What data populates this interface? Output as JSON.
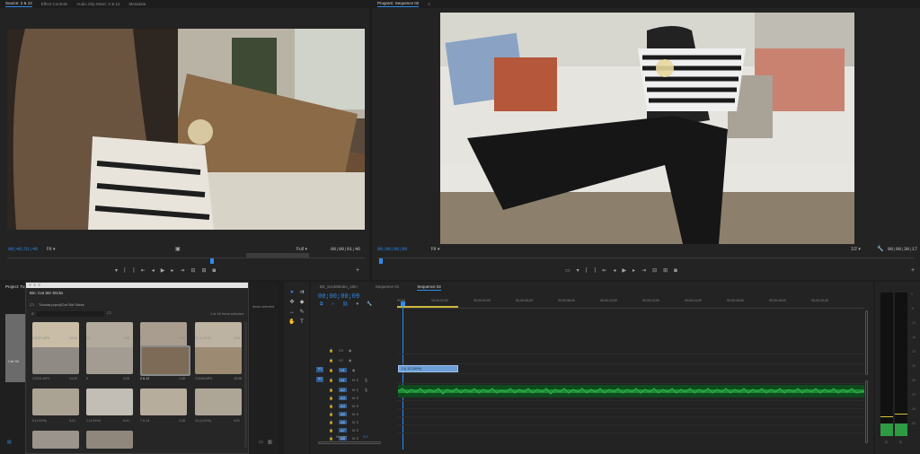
{
  "source_monitor": {
    "tabs": [
      {
        "label": "Source: 2 & 12",
        "active": true
      },
      {
        "label": "Effect Controls",
        "active": false
      },
      {
        "label": "Audio Clip Mixer: 2 & 12",
        "active": false
      },
      {
        "label": "Metadata",
        "active": false
      }
    ],
    "timecode_current": "00;40;51;40",
    "fit": "Fit",
    "quality": "Full",
    "timecode_duration": "00;00;01;46"
  },
  "program_monitor": {
    "tab_label": "Program: Sequence 02",
    "timecode_current": "00;00;00;09",
    "fit": "Fit",
    "ratio": "1/2",
    "timecode_duration": "00;00;30;17"
  },
  "project_panel": {
    "tab_label": "Project: Tu",
    "bin_tab_label": "Bin: Cat Stir Sticks",
    "path": "Tutorial.prproj\\Cat Stir Sticks",
    "items_selected": "1 of 18 items selected",
    "partial_selected": "items selected",
    "partial_label": "Cat Sti",
    "thumbnails": [
      {
        "name": "C0027.MP4",
        "dur": "44;26"
      },
      {
        "name": "13",
        "dur": "2;08"
      },
      {
        "name": "8",
        "dur": "2;45"
      },
      {
        "name": "11 (1:2X%)",
        "dur": "4;26"
      },
      {
        "name": "C0021.MP4",
        "dur": "14;20"
      },
      {
        "name": "9",
        "dur": "3;26"
      },
      {
        "name": "2 & 12",
        "dur": "1;46"
      },
      {
        "name": "C0048.MP4",
        "dur": "15;38"
      },
      {
        "name": "6 (1:2X%)",
        "dur": "4;21"
      },
      {
        "name": "1 (1:2X%)",
        "dur": "6;41"
      },
      {
        "name": "7 & 14",
        "dur": "2;28"
      },
      {
        "name": "10 (1:2X%)",
        "dur": "4;21"
      }
    ]
  },
  "timeline": {
    "tabs": [
      {
        "label": "B2_SockWideo_10in",
        "active": false
      },
      {
        "label": "Sequence 01",
        "active": false
      },
      {
        "label": "Sequence 02",
        "active": true
      }
    ],
    "timecode": "00;00;00;09",
    "ruler": [
      "00;00",
      "00;00;02;00",
      "00;00;04;00",
      "00;00;06;00",
      "00;00;08;00",
      "00;00;10;00",
      "00;00;12;00",
      "00;00;14;00",
      "00;00;16;00",
      "00;00;18;00",
      "00;00;20;00"
    ],
    "video_tracks": [
      "V3",
      "V2",
      "V1"
    ],
    "audio_tracks": [
      "A1",
      "A2",
      "A3",
      "A4",
      "A5",
      "A6",
      "A7",
      "A8"
    ],
    "master_label": "Master",
    "master_value": "0.0",
    "clip_label": "2 & 12 [150%]"
  },
  "meter": {
    "scale": [
      "0",
      "-6",
      "-12",
      "-18",
      "-24",
      "-30",
      "-36",
      "-42",
      "-48",
      "-54"
    ],
    "channels": [
      "S",
      "S"
    ]
  },
  "colors": {
    "accent": "#2d8ceb",
    "panel_bg": "#232323",
    "app_bg": "#1d1d1d",
    "audio_waveform": "#1e8a35",
    "video_clip": "#6d9fd6"
  }
}
